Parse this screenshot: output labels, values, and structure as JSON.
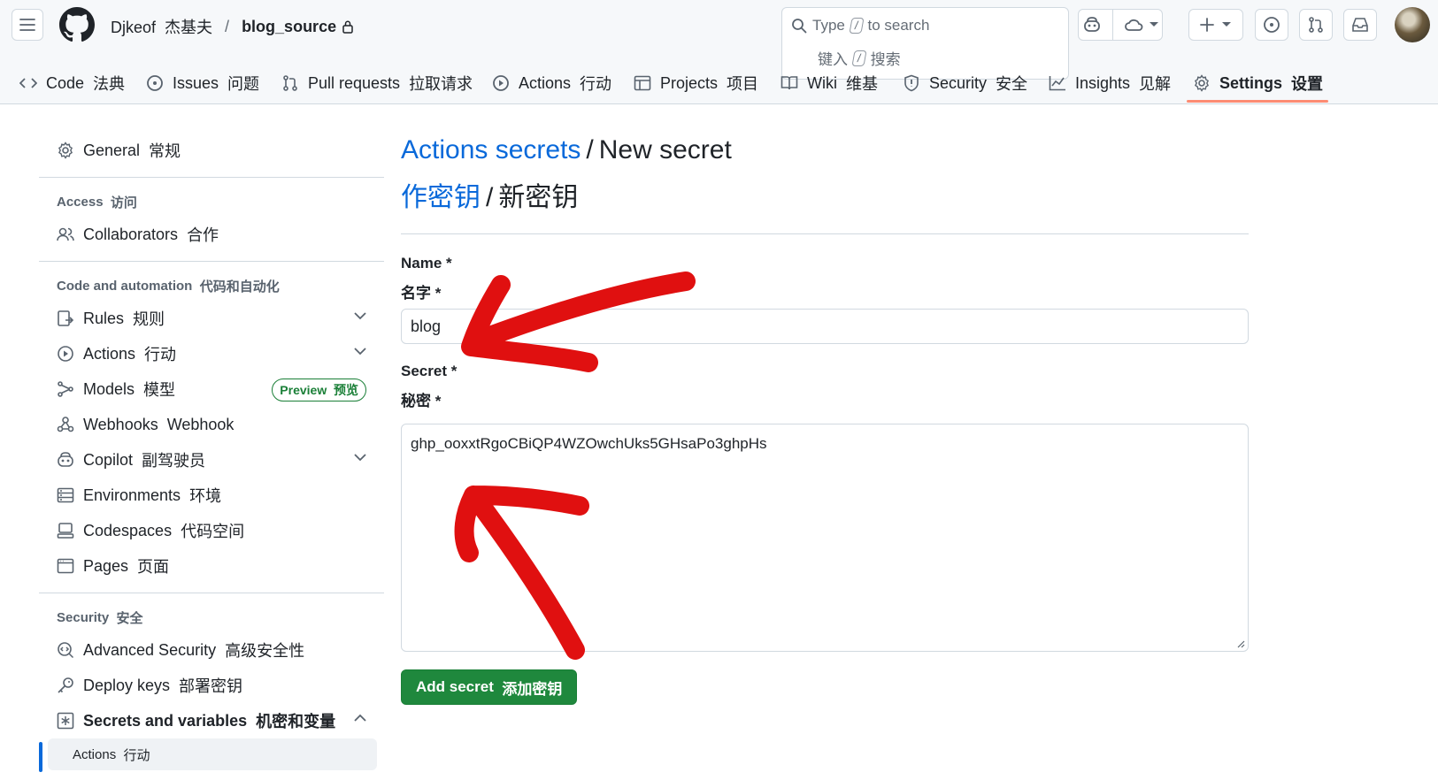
{
  "header": {
    "owner": "Djkeof",
    "owner_cn": "杰基夫",
    "separator": "/",
    "repo": "blog_source",
    "search_l1_a": "Type",
    "search_key": "/",
    "search_l1_b": "to search",
    "search_l2_a": "键入",
    "search_l2_b": "搜索"
  },
  "tabs": [
    {
      "label": "Code",
      "cn": "法典",
      "icon": "code-icon"
    },
    {
      "label": "Issues",
      "cn": "问题",
      "icon": "issue-icon"
    },
    {
      "label": "Pull requests",
      "cn": "拉取请求",
      "icon": "pull-request-icon"
    },
    {
      "label": "Actions",
      "cn": "行动",
      "icon": "play-icon"
    },
    {
      "label": "Projects",
      "cn": "项目",
      "icon": "table-icon"
    },
    {
      "label": "Wiki",
      "cn": "维基",
      "icon": "book-icon"
    },
    {
      "label": "Security",
      "cn": "安全",
      "icon": "shield-icon"
    },
    {
      "label": "Insights",
      "cn": "见解",
      "icon": "graph-icon"
    },
    {
      "label": "Settings",
      "cn": "设置",
      "icon": "gear-icon",
      "active": true
    }
  ],
  "sidebar": {
    "general": {
      "label": "General",
      "cn": "常规"
    },
    "access_head": {
      "label": "Access",
      "cn": "访问"
    },
    "collaborators": {
      "label": "Collaborators",
      "cn": "合作"
    },
    "automation_head": {
      "label": "Code and automation",
      "cn": "代码和自动化"
    },
    "rules": {
      "label": "Rules",
      "cn": "规则"
    },
    "actions": {
      "label": "Actions",
      "cn": "行动"
    },
    "models": {
      "label": "Models",
      "cn": "模型",
      "badge": "Preview",
      "badge_cn": "预览"
    },
    "webhooks": {
      "label": "Webhooks",
      "cn": "Webhook"
    },
    "copilot": {
      "label": "Copilot",
      "cn": "副驾驶员"
    },
    "environments": {
      "label": "Environments",
      "cn": "环境"
    },
    "codespaces": {
      "label": "Codespaces",
      "cn": "代码空间"
    },
    "pages": {
      "label": "Pages",
      "cn": "页面"
    },
    "security_head": {
      "label": "Security",
      "cn": "安全"
    },
    "advanced_security": {
      "label": "Advanced Security",
      "cn": "高级安全性"
    },
    "deploy_keys": {
      "label": "Deploy keys",
      "cn": "部署密钥"
    },
    "secrets": {
      "label": "Secrets and variables",
      "cn": "机密和变量"
    },
    "secrets_actions": {
      "label": "Actions",
      "cn": "行动"
    }
  },
  "main": {
    "title_link": "Actions secrets",
    "title_sep": "/",
    "title_rest": "New secret",
    "title_link_cn": "作密钥",
    "title_rest_cn": "新密钥",
    "name_label": "Name *",
    "name_label_cn": "名字 *",
    "name_value": "blog",
    "secret_label": "Secret *",
    "secret_label_cn": "秘密 *",
    "secret_value": "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",
    "submit_label": "Add secret",
    "submit_label_cn": "添加密钥"
  },
  "colors": {
    "link": "#0969da",
    "green": "#1f883d",
    "tab_underline": "#fd8c73",
    "annotation": "#e01010"
  }
}
